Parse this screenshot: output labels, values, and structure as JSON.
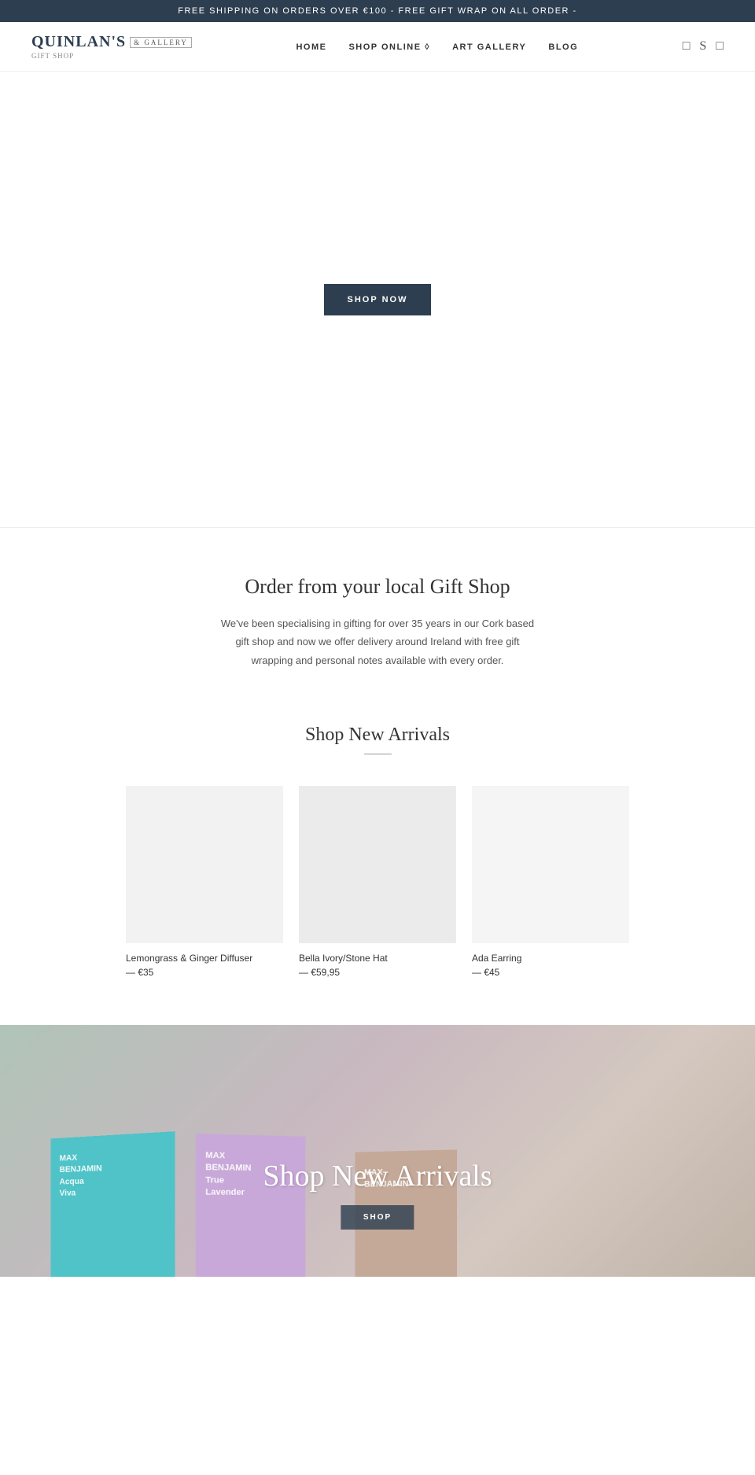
{
  "banner": {
    "text": "FREE SHIPPING ON ORDERS OVER €100 - FREE GIFT WRAP ON ALL ORDER -"
  },
  "nav": {
    "logo_main": "QUINLAN'S",
    "logo_sub": "& GALLERY",
    "logo_tagline": "GIFT SHOP",
    "links": [
      {
        "label": "HOME",
        "id": "home"
      },
      {
        "label": "SHOP ONLINE ◊",
        "id": "shop-online"
      },
      {
        "label": "ART GALLERY",
        "id": "art-gallery"
      },
      {
        "label": "BLOG",
        "id": "blog"
      }
    ]
  },
  "hero": {
    "shop_now_label": "SHOP NOW"
  },
  "info": {
    "title": "Order from your local Gift Shop",
    "text": "We've been specialising in gifting for over 35 years in our Cork based gift shop and now we offer delivery around Ireland with free gift wrapping and personal notes available with every order."
  },
  "arrivals": {
    "title": "Shop New Arrivals",
    "products": [
      {
        "name": "Lemongrass & Ginger Diffuser",
        "price": "— €35",
        "image_type": "light-gray"
      },
      {
        "name": "Bella Ivory/Stone Hat",
        "price": "— €59,95",
        "image_type": "medium-gray"
      },
      {
        "name": "Ada Earring",
        "price": "— €45",
        "image_type": "white-gray"
      }
    ]
  },
  "bottom_banner": {
    "title": "Shop New Arrivals",
    "shop_label": "SHOP",
    "boxes": [
      {
        "label": "MAX\nBENJAMIN\nAcqua\nViva",
        "color": "#4fc3c7"
      },
      {
        "label": "MAX\nBENJAMIN\nTrue\nLavender",
        "color": "#c8a8d8"
      },
      {
        "label": "MAX\nBENJAMIN",
        "color": "#c4a898"
      }
    ]
  }
}
